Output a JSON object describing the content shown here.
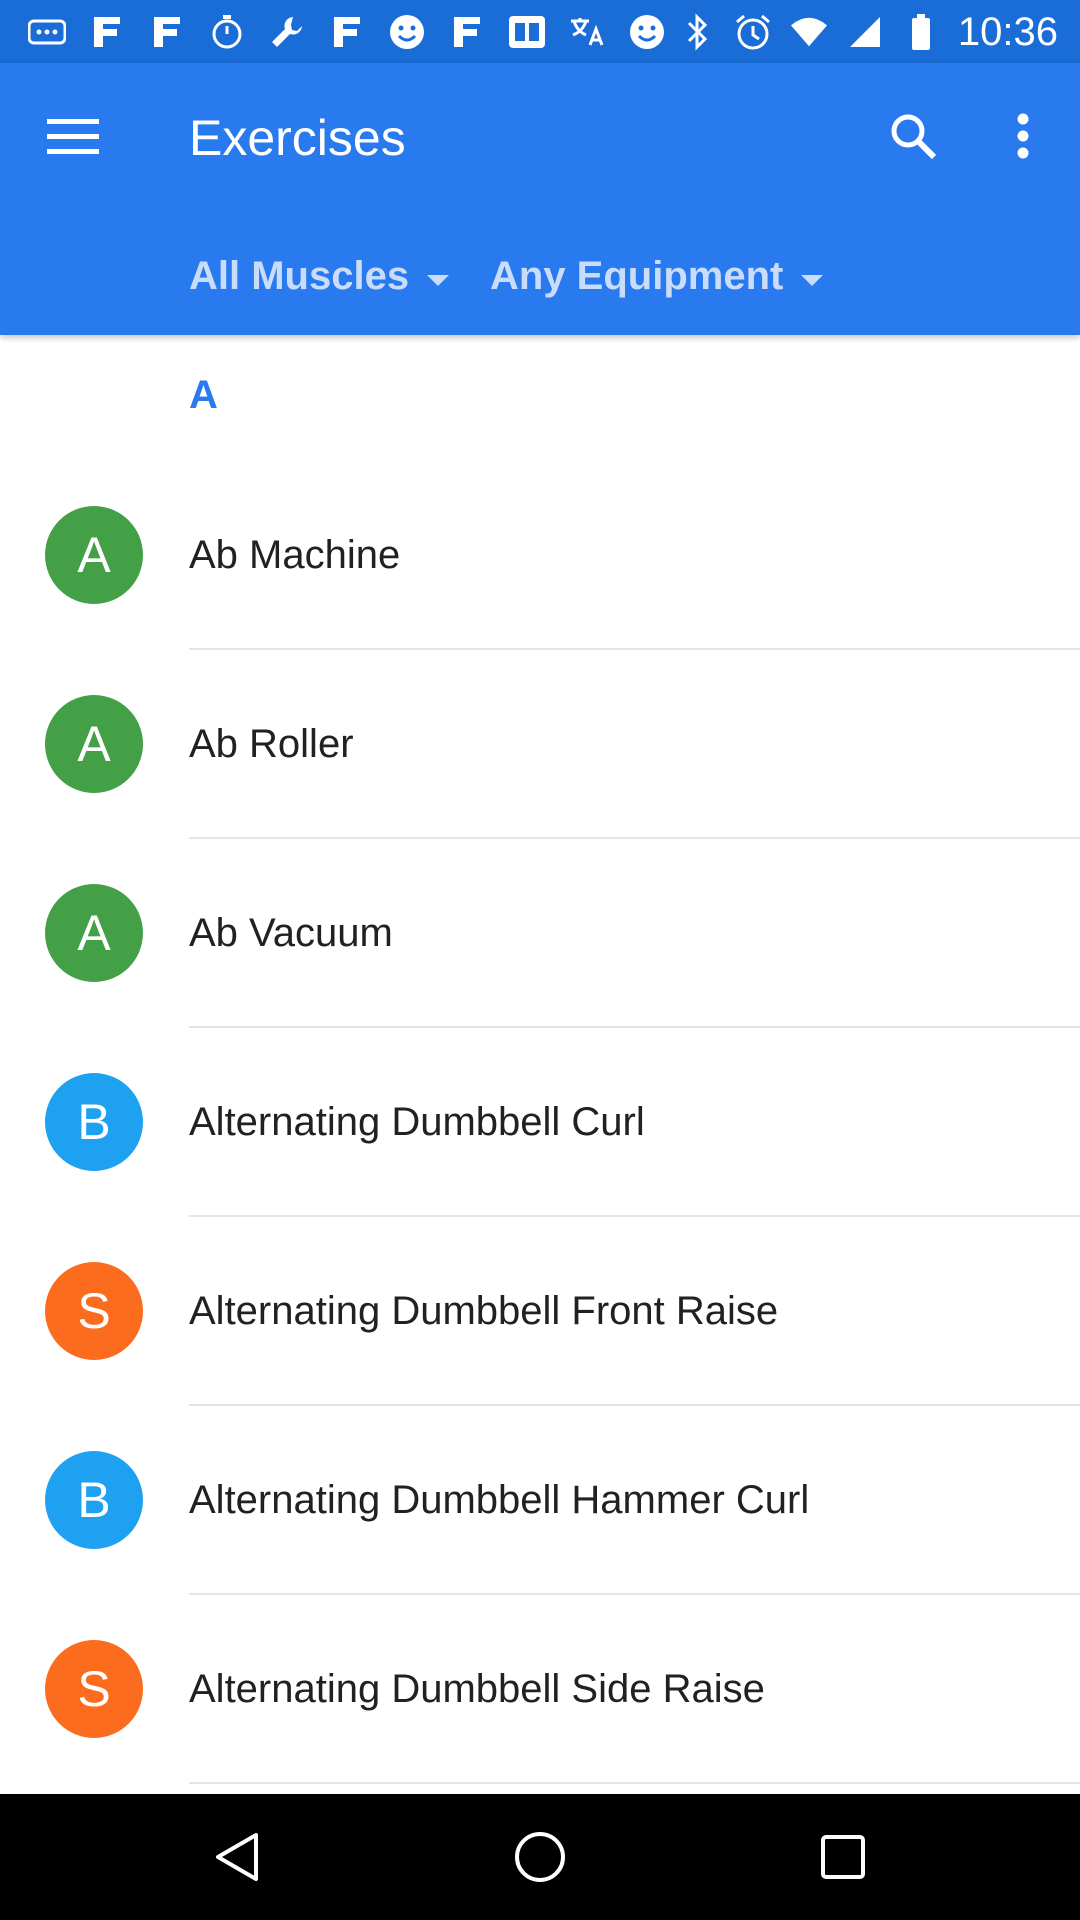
{
  "status_bar": {
    "time": "10:36",
    "left_icons": [
      "more-dots-icon",
      "fb-icon",
      "fb-icon",
      "stopwatch-icon",
      "wrench-icon",
      "fb-icon",
      "smiley-icon",
      "fb-icon",
      "qr-app-icon",
      "translate-icon",
      "smiley-icon"
    ],
    "right_icons": [
      "bluetooth-icon",
      "alarm-icon",
      "wifi-icon",
      "signal-icon",
      "battery-icon"
    ]
  },
  "app_bar": {
    "title": "Exercises",
    "filters": {
      "muscles": "All Muscles",
      "equipment": "Any Equipment"
    }
  },
  "list": {
    "section": "A",
    "items": [
      {
        "label": "Ab Machine",
        "letter": "A",
        "color": "#43a047"
      },
      {
        "label": "Ab Roller",
        "letter": "A",
        "color": "#43a047"
      },
      {
        "label": "Ab Vacuum",
        "letter": "A",
        "color": "#43a047"
      },
      {
        "label": "Alternating Dumbbell Curl",
        "letter": "B",
        "color": "#1ea1f1"
      },
      {
        "label": "Alternating Dumbbell Front Raise",
        "letter": "S",
        "color": "#fb6c1e"
      },
      {
        "label": "Alternating Dumbbell Hammer Curl",
        "letter": "B",
        "color": "#1ea1f1"
      },
      {
        "label": "Alternating Dumbbell Side Raise",
        "letter": "S",
        "color": "#fb6c1e"
      }
    ]
  },
  "colors": {
    "status_bar": "#1a6cd6",
    "app_bar": "#2979ef",
    "filter_text": "#c9ddfb",
    "section_letter": "#2979ef",
    "nav_bar": "#000000"
  },
  "nav_bar": {
    "icons": [
      "back-icon",
      "home-icon",
      "recents-icon"
    ]
  }
}
